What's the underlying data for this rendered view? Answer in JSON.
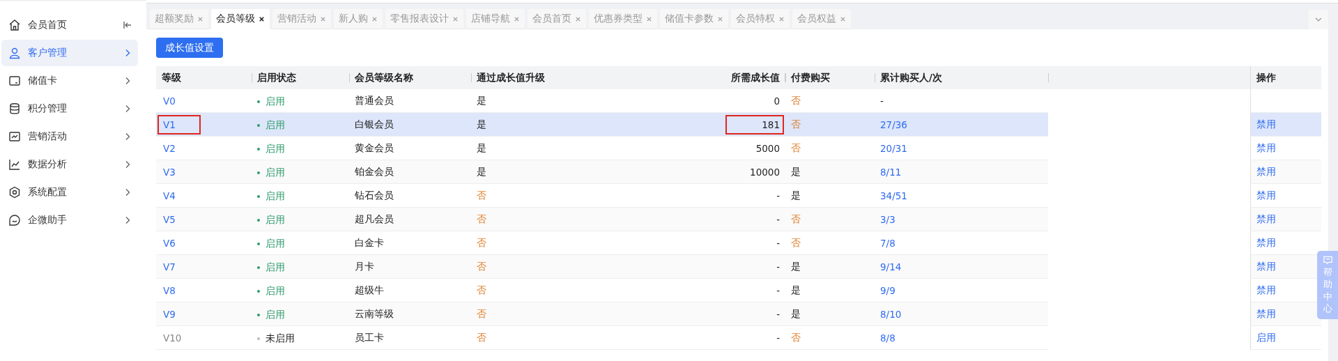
{
  "sidebar": {
    "items": [
      {
        "label": "会员首页",
        "selected": false
      },
      {
        "label": "客户管理",
        "selected": true
      },
      {
        "label": "储值卡",
        "selected": false
      },
      {
        "label": "积分管理",
        "selected": false
      },
      {
        "label": "营销活动",
        "selected": false
      },
      {
        "label": "数据分析",
        "selected": false
      },
      {
        "label": "系统配置",
        "selected": false
      },
      {
        "label": "企微助手",
        "selected": false
      }
    ]
  },
  "tabs": [
    {
      "label": "超额奖励",
      "selected": false
    },
    {
      "label": "会员等级",
      "selected": true
    },
    {
      "label": "营销活动",
      "selected": false
    },
    {
      "label": "新人购",
      "selected": false
    },
    {
      "label": "零售报表设计",
      "selected": false
    },
    {
      "label": "店铺导航",
      "selected": false
    },
    {
      "label": "会员首页",
      "selected": false
    },
    {
      "label": "优惠券类型",
      "selected": false
    },
    {
      "label": "储值卡参数",
      "selected": false
    },
    {
      "label": "会员特权",
      "selected": false
    },
    {
      "label": "会员权益",
      "selected": false
    }
  ],
  "toolbar": {
    "button": "成长值设置"
  },
  "table": {
    "columns": [
      "等级",
      "启用状态",
      "会员等级名称",
      "通过成长值升级",
      "所需成长值",
      "付费购买",
      "累计购买人/次",
      "操作"
    ],
    "rows": [
      {
        "level": "V0",
        "enabled": true,
        "status": "启用",
        "name": "普通会员",
        "upgrade": {
          "text": "是",
          "yes": true
        },
        "growth": "0",
        "paid": {
          "text": "否",
          "yes": false
        },
        "count": {
          "text": "-",
          "link": false
        },
        "action": "",
        "selected": false,
        "marked": false
      },
      {
        "level": "V1",
        "enabled": true,
        "status": "启用",
        "name": "白银会员",
        "upgrade": {
          "text": "是",
          "yes": true
        },
        "growth": "181",
        "paid": {
          "text": "否",
          "yes": false
        },
        "count": {
          "text": "27/36",
          "link": true
        },
        "action": "禁用",
        "selected": true,
        "marked": true
      },
      {
        "level": "V2",
        "enabled": true,
        "status": "启用",
        "name": "黄金会员",
        "upgrade": {
          "text": "是",
          "yes": true
        },
        "growth": "5000",
        "paid": {
          "text": "否",
          "yes": false
        },
        "count": {
          "text": "20/31",
          "link": true
        },
        "action": "禁用",
        "selected": false,
        "marked": false
      },
      {
        "level": "V3",
        "enabled": true,
        "status": "启用",
        "name": "铂金会员",
        "upgrade": {
          "text": "是",
          "yes": true
        },
        "growth": "10000",
        "paid": {
          "text": "是",
          "yes": true
        },
        "count": {
          "text": "8/11",
          "link": true
        },
        "action": "禁用",
        "selected": false,
        "marked": false
      },
      {
        "level": "V4",
        "enabled": true,
        "status": "启用",
        "name": "钻石会员",
        "upgrade": {
          "text": "否",
          "yes": false
        },
        "growth": "-",
        "paid": {
          "text": "是",
          "yes": true
        },
        "count": {
          "text": "34/51",
          "link": true
        },
        "action": "禁用",
        "selected": false,
        "marked": false
      },
      {
        "level": "V5",
        "enabled": true,
        "status": "启用",
        "name": "超凡会员",
        "upgrade": {
          "text": "否",
          "yes": false
        },
        "growth": "-",
        "paid": {
          "text": "否",
          "yes": false
        },
        "count": {
          "text": "3/3",
          "link": true
        },
        "action": "禁用",
        "selected": false,
        "marked": false
      },
      {
        "level": "V6",
        "enabled": true,
        "status": "启用",
        "name": "白金卡",
        "upgrade": {
          "text": "否",
          "yes": false
        },
        "growth": "-",
        "paid": {
          "text": "否",
          "yes": false
        },
        "count": {
          "text": "7/8",
          "link": true
        },
        "action": "禁用",
        "selected": false,
        "marked": false
      },
      {
        "level": "V7",
        "enabled": true,
        "status": "启用",
        "name": "月卡",
        "upgrade": {
          "text": "否",
          "yes": false
        },
        "growth": "-",
        "paid": {
          "text": "是",
          "yes": true
        },
        "count": {
          "text": "9/14",
          "link": true
        },
        "action": "禁用",
        "selected": false,
        "marked": false
      },
      {
        "level": "V8",
        "enabled": true,
        "status": "启用",
        "name": "超级牛",
        "upgrade": {
          "text": "否",
          "yes": false
        },
        "growth": "-",
        "paid": {
          "text": "是",
          "yes": true
        },
        "count": {
          "text": "9/9",
          "link": true
        },
        "action": "禁用",
        "selected": false,
        "marked": false
      },
      {
        "level": "V9",
        "enabled": true,
        "status": "启用",
        "name": "云南等级",
        "upgrade": {
          "text": "否",
          "yes": false
        },
        "growth": "-",
        "paid": {
          "text": "是",
          "yes": true
        },
        "count": {
          "text": "8/10",
          "link": true
        },
        "action": "禁用",
        "selected": false,
        "marked": false
      },
      {
        "level": "V10",
        "enabled": false,
        "status": "未启用",
        "name": "员工卡",
        "upgrade": {
          "text": "否",
          "yes": false
        },
        "growth": "-",
        "paid": {
          "text": "否",
          "yes": false
        },
        "count": {
          "text": "8/8",
          "link": true
        },
        "action": "启用",
        "selected": false,
        "marked": false
      }
    ]
  },
  "help": {
    "label": "帮助中心"
  }
}
